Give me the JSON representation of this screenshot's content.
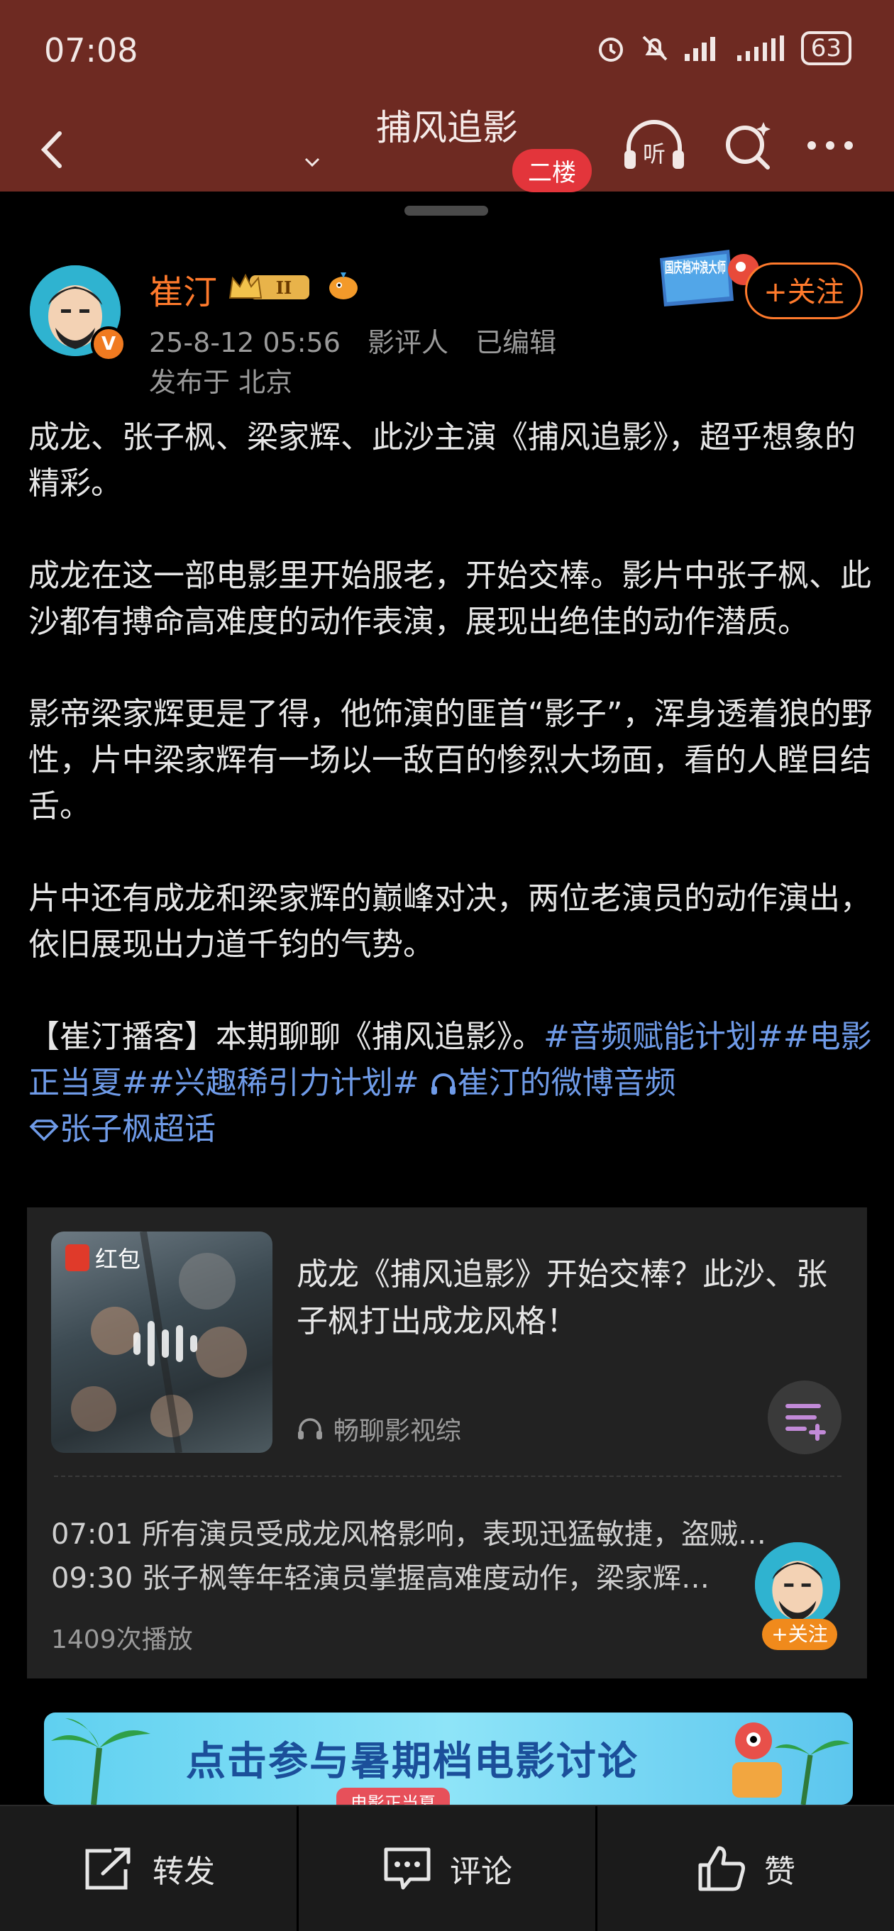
{
  "status_bar": {
    "time": "07:08",
    "battery": "63"
  },
  "nav": {
    "title": "捕风追影",
    "floor_badge": "二楼",
    "listen_label": "听"
  },
  "post": {
    "author": {
      "name": "崔汀",
      "crown_level": "II",
      "verified_badge": "V"
    },
    "meta": {
      "date": "25-8-12 05:56",
      "role": "影评人",
      "edited": "已编辑",
      "location": "发布于 北京"
    },
    "promo_badge": "国庆档冲浪大师",
    "follow_label": "+关注",
    "paragraphs": [
      "成龙、张子枫、梁家辉、此沙主演《捕风追影》，超乎想象的精彩。",
      "成龙在这一部电影里开始服老，开始交棒。影片中张子枫、此沙都有搏命高难度的动作表演，展现出绝佳的动作潜质。",
      "影帝梁家辉更是了得，他饰演的匪首“影子”，浑身透着狼的野性，片中梁家辉有一场以一敌百的惨烈大场面，看的人瞠目结舌。",
      "片中还有成龙和梁家辉的巅峰对决，两位老演员的动作演出，依旧展现出力道千钧的气势。"
    ],
    "final": {
      "prefix": "【崔汀播客】本期聊聊《捕风追影》。",
      "tag1": "#音频赋能计划#",
      "tag2": "#电影正当夏#",
      "tag3": "#兴趣稀引力计划#",
      "audio_link": "崔汀的微博音频",
      "super_topic": "张子枫超话"
    }
  },
  "audio_card": {
    "redpacket_label": "红包",
    "title": "成龙《捕风追影》开始交棒？此沙、张子枫打出成龙风格！",
    "source": "畅聊影视综",
    "chapters": [
      "07:01 所有演员受成龙风格影响，表现迅猛敏捷，盗贼…",
      "09:30 张子枫等年轻演员掌握高难度动作，梁家辉…"
    ],
    "play_count": "1409次播放"
  },
  "floating": {
    "follow_label": "+关注"
  },
  "banner": {
    "text": "点击参与暑期档电影讨论",
    "tag": "电影正当夏"
  },
  "bottom_bar": {
    "repost": "转发",
    "comment": "评论",
    "like": "赞"
  },
  "colors": {
    "header_bg": "#6e2a22",
    "accent_orange": "#ff7a2c",
    "link_blue": "#6f9be8",
    "badge_red": "#e3353b"
  }
}
